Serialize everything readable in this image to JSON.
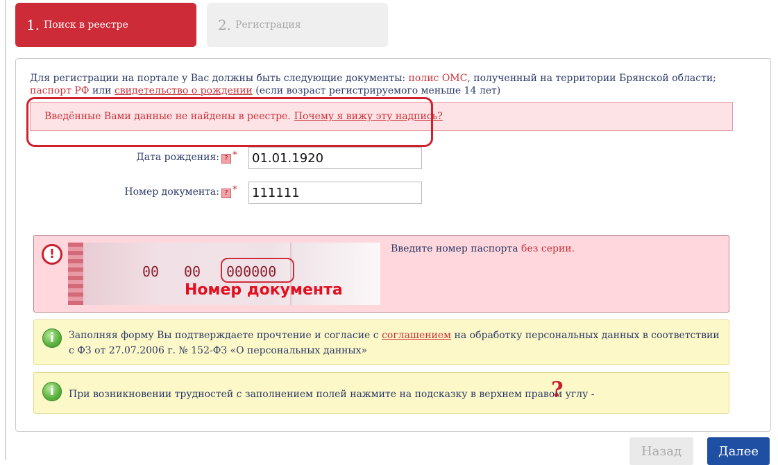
{
  "steps": [
    {
      "num": "1.",
      "label": "Поиск в реестре",
      "active": true
    },
    {
      "num": "2.",
      "label": "Регистрация",
      "active": false
    }
  ],
  "intro": {
    "part1": "Для регистрации на портале у Вас должны быть следующие документы: ",
    "link_oms": "полис ОМС",
    "part2": ", полученный на территории Брянской области; ",
    "link_passport": "паспорт РФ",
    "part3_or": "или",
    "link_birth": "свидетельство о рождении",
    "part4": " (если возраст регистрируемого меньше 14 лет)"
  },
  "error": {
    "message": "Введённые Вами данные не найдены в реестре.",
    "link": "Почему я вижу эту надпись?"
  },
  "form": {
    "birth_date": {
      "label": "Дата рождения:",
      "help": "?",
      "required": "*",
      "value": "01.01.1920"
    },
    "doc_number": {
      "label": "Номер документа:",
      "help": "?",
      "required": "*",
      "value": "111111"
    }
  },
  "passport_hint": {
    "icon": "exclamation-icon",
    "image_series_1": "00",
    "image_series_2": "00",
    "image_number": "000000",
    "image_caption": "Номер документа",
    "text": "Введите номер паспорта ",
    "text_red": "без серии."
  },
  "consent": {
    "icon": "info-icon",
    "part1": "Заполняя форму Вы подтверждаете прочтение и согласие с ",
    "link": "соглашением",
    "part2": " на обработку персональных данных в соответствии с ФЗ от 27.07.2006 г. № 152-ФЗ «О персональных данных»"
  },
  "hint": {
    "icon": "info-icon",
    "text": "При возникновении трудностей с заполнением полей нажмите на подсказку в верхнем правом углу -",
    "question_mark": "?"
  },
  "buttons": {
    "back": "Назад",
    "next": "Далее"
  },
  "colors": {
    "accent_red": "#cd2b37",
    "primary_blue": "#1f4fa3",
    "error_bg": "#fde3e5",
    "info_bg": "#fcf8c8"
  }
}
